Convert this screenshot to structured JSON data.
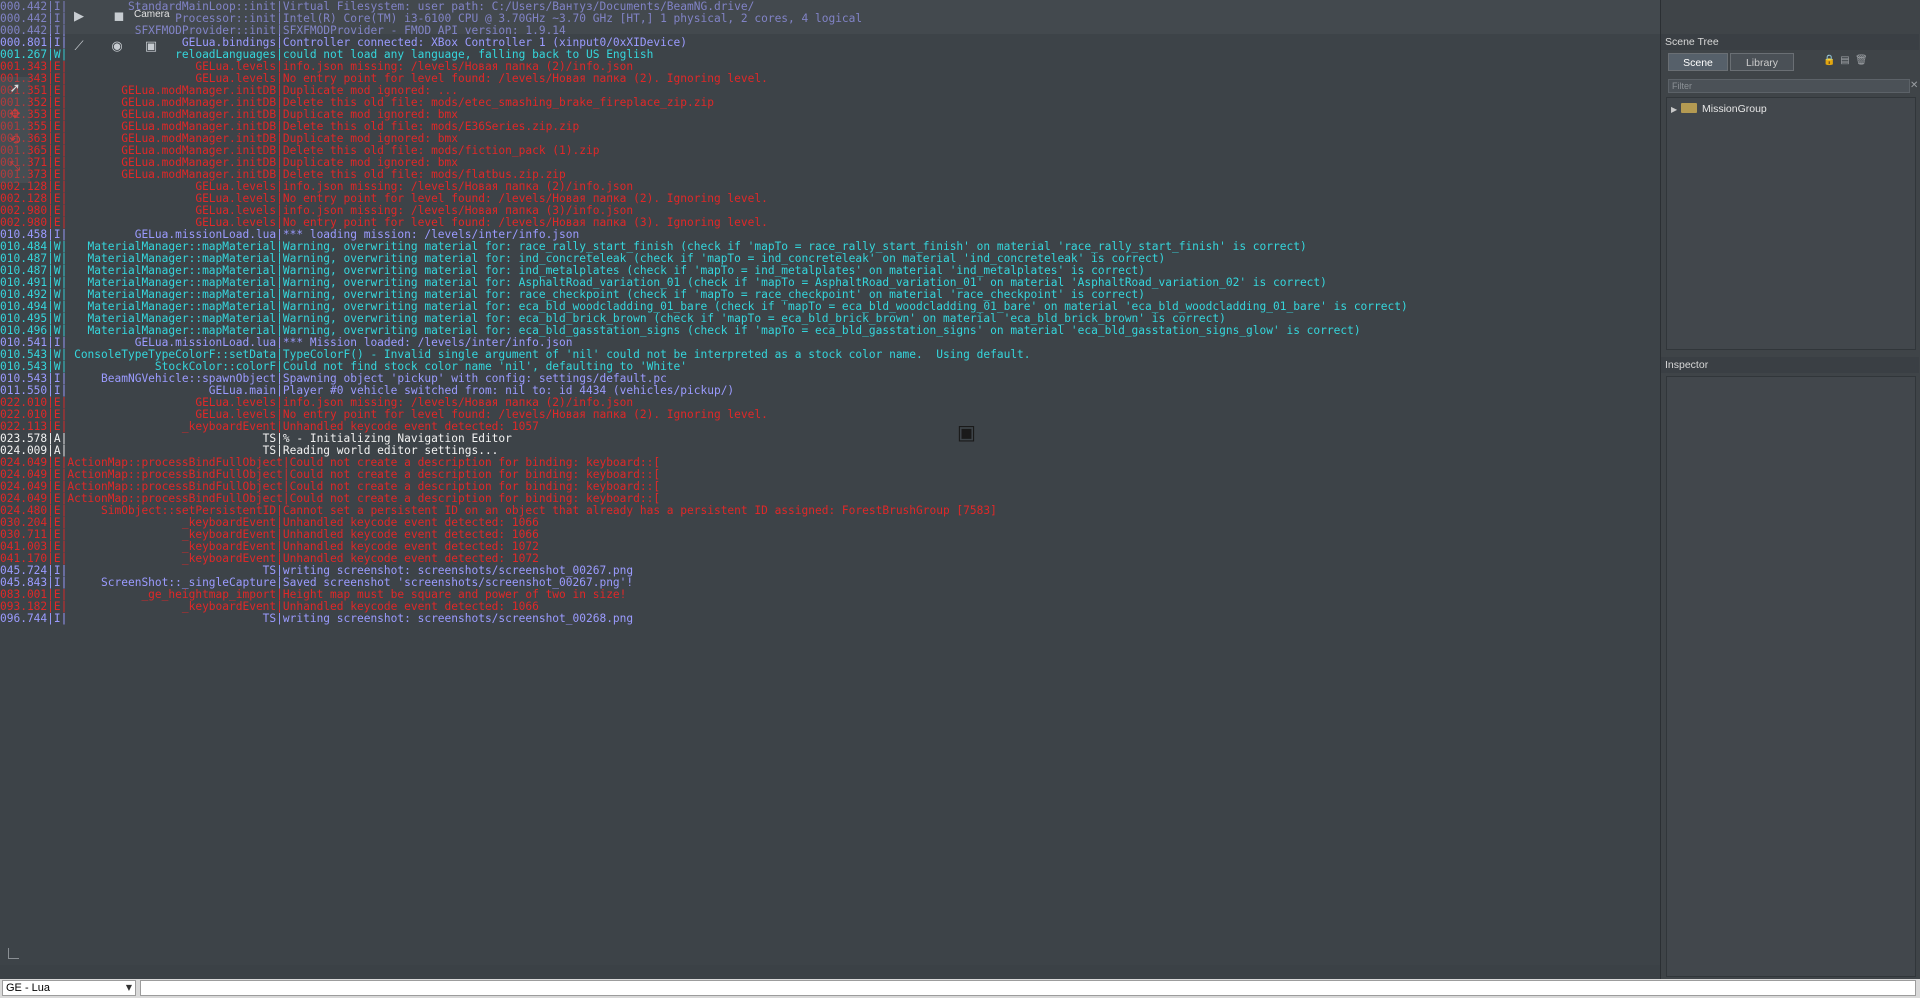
{
  "toolbar": {
    "camera_label": "Camera",
    "icons": [
      "play-icon",
      "camera-icon",
      "move-icon",
      "sphere-icon",
      "cube-icon"
    ]
  },
  "left_toolbar": {
    "icons": [
      "select-arrow-icon",
      "translate-icon",
      "rotate-icon",
      "scale-icon"
    ]
  },
  "log": [
    {
      "t": "000.442",
      "l": "I",
      "src": "StandardMainLoop::init",
      "msg": "Virtual Filesystem: user path: C:/Users/Вантуз/Documents/BeamNG.drive/"
    },
    {
      "t": "000.442",
      "l": "I",
      "src": "Processor::init",
      "msg": "Intel(R) Core(TM) i3-6100 CPU @ 3.70GHz ~3.70 GHz [HT,] 1 physical, 2 cores, 4 logical"
    },
    {
      "t": "000.442",
      "l": "I",
      "src": "SFXFMODProvider::init",
      "msg": "SFXFMODProvider - FMOD API version: 1.9.14"
    },
    {
      "t": "000.801",
      "l": "I",
      "src": "GELua.bindings",
      "msg": "Controller connected: XBox Controller 1 (xinput0/0xXIDevice)"
    },
    {
      "t": "001.267",
      "l": "W",
      "src": "reloadLanguages",
      "msg": "could not load any language, falling back to US English"
    },
    {
      "t": "001.343",
      "l": "E",
      "src": "GELua.levels",
      "msg": "info.json missing: /levels/Новая папка (2)/info.json"
    },
    {
      "t": "001.343",
      "l": "E",
      "src": "GELua.levels",
      "msg": "No entry point for level found: /levels/Новая папка (2). Ignoring level."
    },
    {
      "t": "001.351",
      "l": "E",
      "src": "GELua.modManager.initDB",
      "msg": "Duplicate mod ignored: ..."
    },
    {
      "t": "001.352",
      "l": "E",
      "src": "GELua.modManager.initDB",
      "msg": "Delete this old file: mods/etec_smashing_brake_fireplace_zip.zip"
    },
    {
      "t": "001.353",
      "l": "E",
      "src": "GELua.modManager.initDB",
      "msg": "Duplicate mod ignored: bmx"
    },
    {
      "t": "001.355",
      "l": "E",
      "src": "GELua.modManager.initDB",
      "msg": "Delete this old file: mods/E36Series.zip.zip"
    },
    {
      "t": "001.363",
      "l": "E",
      "src": "GELua.modManager.initDB",
      "msg": "Duplicate mod ignored: bmx"
    },
    {
      "t": "001.365",
      "l": "E",
      "src": "GELua.modManager.initDB",
      "msg": "Delete this old file: mods/fiction_pack (1).zip"
    },
    {
      "t": "001.371",
      "l": "E",
      "src": "GELua.modManager.initDB",
      "msg": "Duplicate mod ignored: bmx"
    },
    {
      "t": "001.373",
      "l": "E",
      "src": "GELua.modManager.initDB",
      "msg": "Delete this old file: mods/flatbus.zip.zip"
    },
    {
      "t": "002.128",
      "l": "E",
      "src": "GELua.levels",
      "msg": "info.json missing: /levels/Новая папка (2)/info.json"
    },
    {
      "t": "002.128",
      "l": "E",
      "src": "GELua.levels",
      "msg": "No entry point for level found: /levels/Новая папка (2). Ignoring level."
    },
    {
      "t": "002.980",
      "l": "E",
      "src": "GELua.levels",
      "msg": "info.json missing: /levels/Новая папка (3)/info.json"
    },
    {
      "t": "002.980",
      "l": "E",
      "src": "GELua.levels",
      "msg": "No entry point for level found: /levels/Новая папка (3). Ignoring level."
    },
    {
      "t": "010.458",
      "l": "I",
      "src": "GELua.missionLoad.lua",
      "msg": "*** loading mission: /levels/inter/info.json"
    },
    {
      "t": "010.484",
      "l": "W",
      "src": "MaterialManager::mapMaterial",
      "msg": "Warning, overwriting material for: race_rally_start_finish (check if 'mapTo = race_rally_start_finish' on material 'race_rally_start_finish' is correct)"
    },
    {
      "t": "010.487",
      "l": "W",
      "src": "MaterialManager::mapMaterial",
      "msg": "Warning, overwriting material for: ind_concreteleak (check if 'mapTo = ind_concreteleak' on material 'ind_concreteleak' is correct)"
    },
    {
      "t": "010.487",
      "l": "W",
      "src": "MaterialManager::mapMaterial",
      "msg": "Warning, overwriting material for: ind_metalplates (check if 'mapTo = ind_metalplates' on material 'ind_metalplates' is correct)"
    },
    {
      "t": "010.491",
      "l": "W",
      "src": "MaterialManager::mapMaterial",
      "msg": "Warning, overwriting material for: AsphaltRoad_variation_01 (check if 'mapTo = AsphaltRoad_variation_01' on material 'AsphaltRoad_variation_02' is correct)"
    },
    {
      "t": "010.492",
      "l": "W",
      "src": "MaterialManager::mapMaterial",
      "msg": "Warning, overwriting material for: race_checkpoint (check if 'mapTo = race_checkpoint' on material 'race_checkpoint' is correct)"
    },
    {
      "t": "010.494",
      "l": "W",
      "src": "MaterialManager::mapMaterial",
      "msg": "Warning, overwriting material for: eca_bld_woodcladding_01_bare (check if 'mapTo = eca_bld_woodcladding_01_bare' on material 'eca_bld_woodcladding_01_bare' is correct)"
    },
    {
      "t": "010.495",
      "l": "W",
      "src": "MaterialManager::mapMaterial",
      "msg": "Warning, overwriting material for: eca_bld_brick_brown (check if 'mapTo = eca_bld_brick_brown' on material 'eca_bld_brick_brown' is correct)"
    },
    {
      "t": "010.496",
      "l": "W",
      "src": "MaterialManager::mapMaterial",
      "msg": "Warning, overwriting material for: eca_bld_gasstation_signs (check if 'mapTo = eca_bld_gasstation_signs' on material 'eca_bld_gasstation_signs_glow' is correct)"
    },
    {
      "t": "010.541",
      "l": "I",
      "src": "GELua.missionLoad.lua",
      "msg": "*** Mission loaded: /levels/inter/info.json"
    },
    {
      "t": "010.543",
      "l": "W",
      "src": "ConsoleTypeTypeColorF::setData",
      "msg": "TypeColorF() - Invalid single argument of 'nil' could not be interpreted as a stock color name.  Using default."
    },
    {
      "t": "010.543",
      "l": "W",
      "src": "StockColor::colorF",
      "msg": "Could not find stock color name 'nil', defaulting to 'White'"
    },
    {
      "t": "010.543",
      "l": "I",
      "src": "BeamNGVehicle::spawnObject",
      "msg": "Spawning object 'pickup' with config: settings/default.pc"
    },
    {
      "t": "011.550",
      "l": "I",
      "src": "GELua.main",
      "msg": "Player #0 vehicle switched from: nil to: id 4434 (vehicles/pickup/)"
    },
    {
      "t": "022.010",
      "l": "E",
      "src": "GELua.levels",
      "msg": "info.json missing: /levels/Новая папка (2)/info.json"
    },
    {
      "t": "022.010",
      "l": "E",
      "src": "GELua.levels",
      "msg": "No entry point for level found: /levels/Новая папка (2). Ignoring level."
    },
    {
      "t": "022.113",
      "l": "E",
      "src": "_keyboardEvent",
      "msg": "Unhandled keycode event detected: 1057"
    },
    {
      "t": "023.578",
      "l": "A",
      "src": "TS",
      "msg": "% - Initializing Navigation Editor"
    },
    {
      "t": "024.009",
      "l": "A",
      "src": "TS",
      "msg": "Reading world editor settings..."
    },
    {
      "t": "024.049",
      "l": "E",
      "src": "ActionMap::processBindFullObject",
      "msg": "Could not create a description for binding: keyboard::["
    },
    {
      "t": "024.049",
      "l": "E",
      "src": "ActionMap::processBindFullObject",
      "msg": "Could not create a description for binding: keyboard::["
    },
    {
      "t": "024.049",
      "l": "E",
      "src": "ActionMap::processBindFullObject",
      "msg": "Could not create a description for binding: keyboard::["
    },
    {
      "t": "024.049",
      "l": "E",
      "src": "ActionMap::processBindFullObject",
      "msg": "Could not create a description for binding: keyboard::["
    },
    {
      "t": "024.480",
      "l": "E",
      "src": "SimObject::setPersistentID",
      "msg": "Cannot set a persistent ID on an object that already has a persistent ID assigned: ForestBrushGroup [7583]"
    },
    {
      "t": "030.204",
      "l": "E",
      "src": "_keyboardEvent",
      "msg": "Unhandled keycode event detected: 1066"
    },
    {
      "t": "030.711",
      "l": "E",
      "src": "_keyboardEvent",
      "msg": "Unhandled keycode event detected: 1066"
    },
    {
      "t": "041.003",
      "l": "E",
      "src": "_keyboardEvent",
      "msg": "Unhandled keycode event detected: 1072"
    },
    {
      "t": "041.170",
      "l": "E",
      "src": "_keyboardEvent",
      "msg": "Unhandled keycode event detected: 1072"
    },
    {
      "t": "045.724",
      "l": "I",
      "src": "TS",
      "msg": "writing screenshot: screenshots/screenshot_00267.png"
    },
    {
      "t": "045.843",
      "l": "I",
      "src": "ScreenShot::_singleCapture",
      "msg": "Saved screenshot 'screenshots/screenshot_00267.png'!"
    },
    {
      "t": "083.001",
      "l": "E",
      "src": "_ge_heightmap_import",
      "msg": "Height map must be square and power of two in size!"
    },
    {
      "t": "093.182",
      "l": "E",
      "src": "_keyboardEvent",
      "msg": "Unhandled keycode event detected: 1066"
    },
    {
      "t": "096.744",
      "l": "I",
      "src": "TS",
      "msg": "writing screenshot: screenshots/screenshot_00268.png"
    }
  ],
  "bottom_bar": {
    "language_select": "GE - Lua",
    "command_placeholder": ""
  },
  "scene_tree": {
    "title": "Scene Tree",
    "tabs": [
      "Scene",
      "Library"
    ],
    "filter_placeholder": "Filter",
    "items": [
      {
        "label": "MissionGroup"
      }
    ]
  },
  "inspector": {
    "title": "Inspector"
  }
}
